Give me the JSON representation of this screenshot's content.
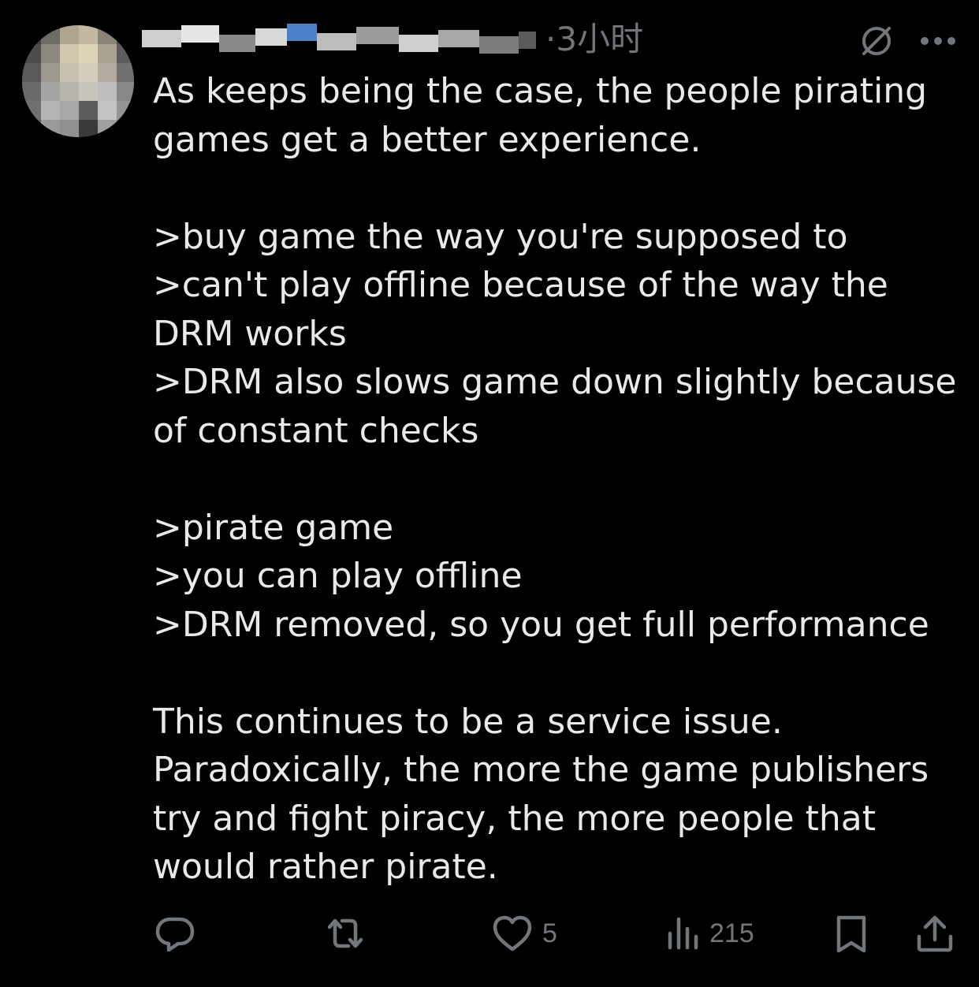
{
  "tweet": {
    "timestamp": "·3小时",
    "text": "As keeps being the case, the people pirating games get a better experience.\n\n>buy game the way you're supposed to\n>can't play offline because of the way the DRM works\n>DRM also slows game down slightly because of constant checks\n\n>pirate game\n>you can play offline\n>DRM removed, so you get full performance\n\nThis continues to be a service issue. Paradoxically, the more the game publishers try and fight piracy, the more people that would rather pirate."
  },
  "icons": {
    "grok": "grok-icon",
    "more": "more-icon",
    "reply": "reply-icon",
    "retweet": "retweet-icon",
    "like": "heart-icon",
    "views": "views-icon",
    "bookmark": "bookmark-icon",
    "share": "share-icon"
  },
  "actions": {
    "likes": "5",
    "views": "215"
  },
  "colors": {
    "background": "#000000",
    "text": "#e7e9ea",
    "muted": "#71767b"
  }
}
